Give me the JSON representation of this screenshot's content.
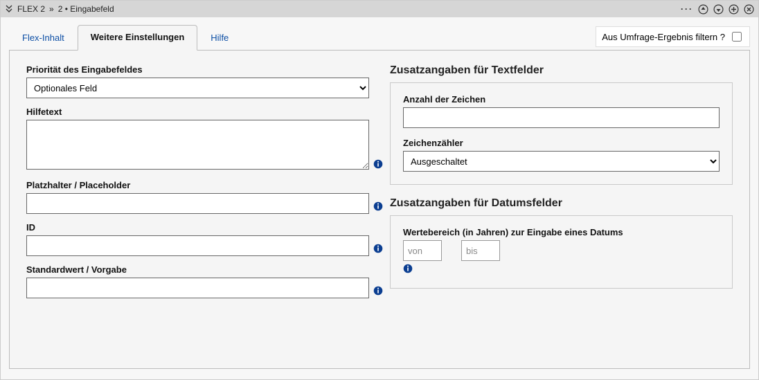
{
  "titlebar": {
    "crumb1": "FLEX 2",
    "sep": "»",
    "crumb2": "2 • Eingabefeld"
  },
  "tabs": {
    "flex": "Flex-Inhalt",
    "more": "Weitere Einstellungen",
    "help": "Hilfe"
  },
  "filter": {
    "label": "Aus Umfrage-Ergebnis filtern ?"
  },
  "left": {
    "priority_label": "Priorität des Eingabefeldes",
    "priority_value": "Optionales Feld",
    "helptext_label": "Hilfetext",
    "helptext_value": "",
    "placeholder_label": "Platzhalter / Placeholder",
    "placeholder_value": "",
    "id_label": "ID",
    "id_value": "",
    "default_label": "Standardwert / Vorgabe",
    "default_value": ""
  },
  "right_text": {
    "section_title": "Zusatzangaben für Textfelder",
    "charcount_label": "Anzahl der Zeichen",
    "charcount_value": "",
    "counter_label": "Zeichenzähler",
    "counter_value": "Ausgeschaltet"
  },
  "right_date": {
    "section_title": "Zusatzangaben für Datumsfelder",
    "range_label": "Wertebereich (in Jahren) zur Eingabe eines Datums",
    "from_placeholder": "von",
    "to_placeholder": "bis"
  }
}
